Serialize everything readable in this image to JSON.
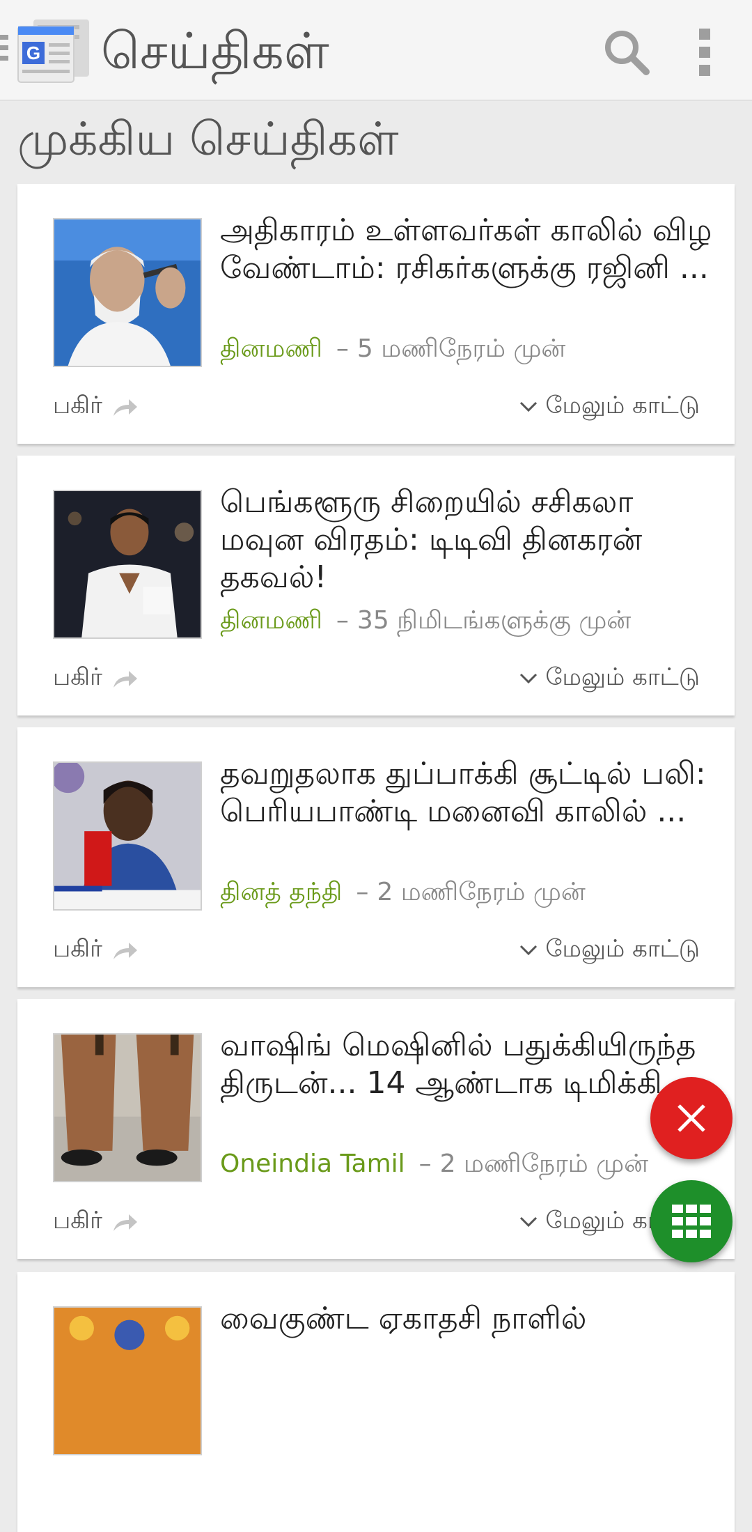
{
  "app_bar": {
    "title": "செய்திகள்",
    "logo_icon": "google-news-logo-icon",
    "search_icon": "search-icon",
    "overflow_icon": "more-vert-icon"
  },
  "section_title": "முக்கிய செய்திகள்",
  "articles": [
    {
      "headline": "அதிகாரம் உள்ளவர்கள் காலில் விழ வேண்டாம்: ரசிகர்களுக்கு ரஜினி ...",
      "source": "தினமணி",
      "time": "5 மணிநேரம் முன்",
      "share_label": "பகிர்",
      "more_label": "மேலும் காட்டு"
    },
    {
      "headline": "பெங்களூரு சிறையில் சசிகலா மவுன விரதம்: டிடிவி தினகரன் தகவல்!",
      "source": "தினமணி",
      "time": "35 நிமிடங்களுக்கு முன்",
      "share_label": "பகிர்",
      "more_label": "மேலும் காட்டு"
    },
    {
      "headline": "தவறுதலாக துப்பாக்கி சூட்டில் பலி: பெரியபாண்டி மனைவி காலில் ...",
      "source": "தினத் தந்தி",
      "time": "2 மணிநேரம் முன்",
      "share_label": "பகிர்",
      "more_label": "மேலும் காட்டு"
    },
    {
      "headline": "வாஷிங் மெஷினில் பதுக்கியிருந்த திருடன்... 14 ஆண்டாக டிமிக்கி ...",
      "source": "Oneindia Tamil",
      "time": "2 மணிநேரம் முன்",
      "share_label": "பகிர்",
      "more_label": "மேலும் காட்டு"
    },
    {
      "headline": "வைகுண்ட ஏகாதசி நாளில்"
    }
  ],
  "fab": {
    "close_icon": "close-icon",
    "apps_icon": "apps-grid-icon"
  },
  "colors": {
    "source_green": "#6a9a1a",
    "fab_red": "#e02020",
    "fab_green": "#1e8f2a"
  }
}
